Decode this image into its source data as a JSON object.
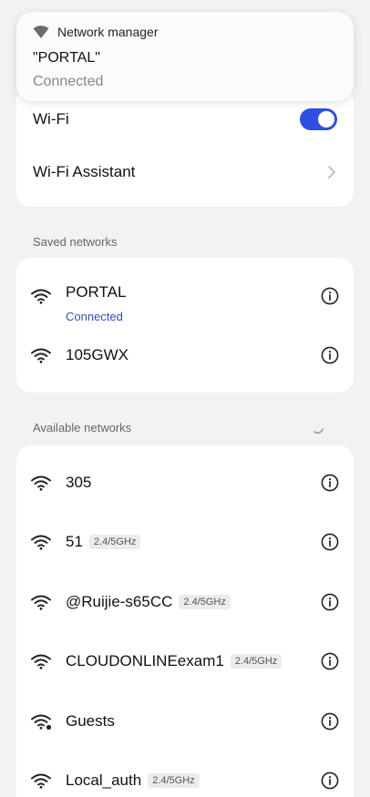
{
  "notification": {
    "app_icon": "wifi-icon",
    "app_name": "Network manager",
    "network_name": "\"PORTAL\"",
    "status": "Connected"
  },
  "wifi": {
    "label": "Wi-Fi",
    "enabled": true,
    "toggle_color": "#2f4fe0"
  },
  "assistant": {
    "label": "Wi-Fi Assistant",
    "icon": "chevron-right-icon"
  },
  "saved": {
    "heading": "Saved networks",
    "networks": [
      {
        "name": "PORTAL",
        "status": "Connected",
        "icon": "wifi-icon",
        "info_icon": "info-icon"
      },
      {
        "name": "105GWX",
        "icon": "wifi-icon",
        "info_icon": "info-icon"
      }
    ]
  },
  "available": {
    "heading": "Available networks",
    "loading_icon": "spinner-icon",
    "networks": [
      {
        "name": "305",
        "badge": "",
        "icon": "wifi-icon"
      },
      {
        "name": "51",
        "badge": "2.4/5GHz",
        "icon": "wifi-icon"
      },
      {
        "name": "@Ruijie-s65CC",
        "badge": "2.4/5GHz",
        "icon": "wifi-icon"
      },
      {
        "name": "CLOUDONLINEexam1",
        "badge": "2.4/5GHz",
        "icon": "wifi-icon"
      },
      {
        "name": "Guests",
        "badge": "",
        "icon": "wifi-open-portal-icon"
      },
      {
        "name": "Local_auth",
        "badge": "2.4/5GHz",
        "icon": "wifi-icon"
      }
    ]
  },
  "colors": {
    "accent": "#2f4fe0",
    "connected_text": "#2f4fb8",
    "background": "#f2f2f4"
  }
}
